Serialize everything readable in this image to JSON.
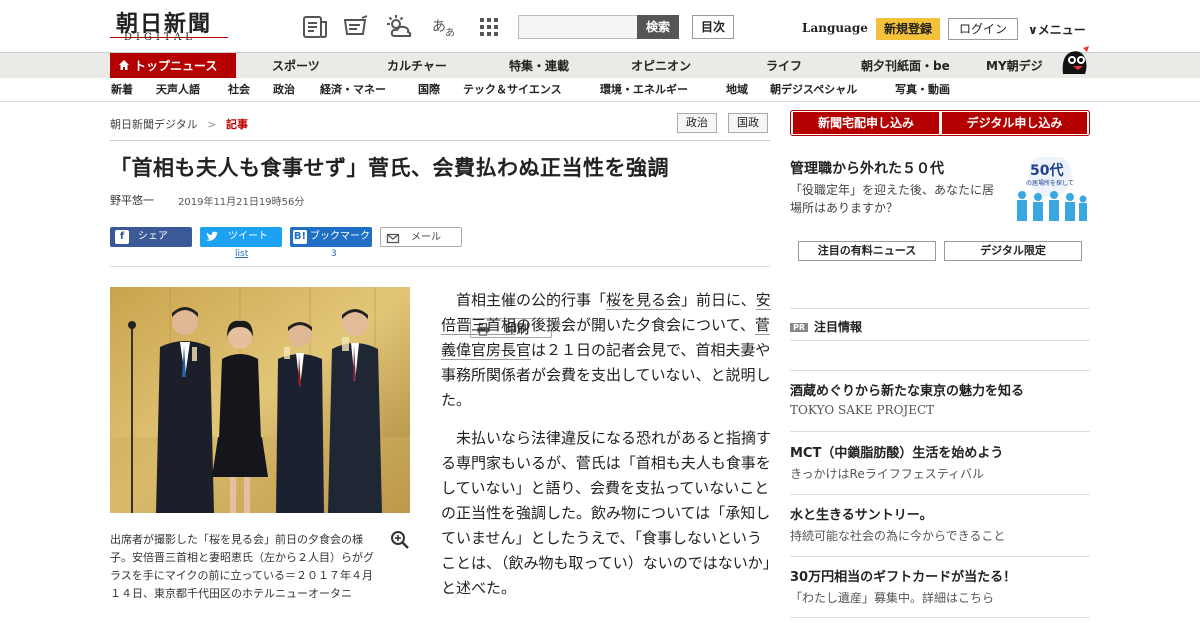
{
  "header": {
    "logo_kanji": "朝日新聞",
    "logo_sub": "DIGITAL",
    "search_button": "検索",
    "index_button": "目次",
    "language": "Language",
    "register": "新規登録",
    "login": "ログイン",
    "menu": "∨メニュー"
  },
  "nav_primary": {
    "top": "トップニュース",
    "items": [
      "スポーツ",
      "カルチャー",
      "特集・連載",
      "オピニオン",
      "ライフ",
      "朝夕刊紙面・be",
      "MY朝デジ"
    ]
  },
  "nav_secondary": {
    "items": [
      "新着",
      "天声人語",
      "社会",
      "政治",
      "経済・マネー",
      "国際",
      "テック＆サイエンス",
      "環境・エネルギー",
      "地域",
      "朝デジスペシャル",
      "写真・動画"
    ]
  },
  "breadcrumb": {
    "home": "朝日新聞デジタル",
    "sep": ">",
    "current": "記事"
  },
  "tags": [
    "政治",
    "国政"
  ],
  "article": {
    "title": "「首相も夫人も食事せず」菅氏、会費払わぬ正当性を強調",
    "author": "野平悠一",
    "date": "2019年11月21日19時56分",
    "caption": "出席者が撮影した「桜を見る会」前日の夕食会の様子。安倍晋三首相と妻昭恵氏（左から２人目）らがグラスを手にマイクの前に立っている＝２０１７年４月１４日、東京都千代田区のホテルニューオータニ",
    "p1_a": "首相主催の公的行事「",
    "p1_link1": "桜を見る会",
    "p1_b": "」前日に、",
    "p1_link2": "安倍晋三首相",
    "p1_c": "の後援会が開いた夕食会について、",
    "p1_link3": "菅義偉官房長官",
    "p1_d": "は２１日の記者会見で、首相夫妻や事務所関係者が会費を支出していない、と説明した。",
    "p2": "未払いなら法律違反になる恐れがあると指摘する専門家もいるが、菅氏は「首相も夫人も食事をしていない」と語り、会費を支払っていないことの正当性を強調した。飲み物については「承知していません」としたうえで、「食事しないということは、（飲み物も取ってい）ないのではないか」と述べた。"
  },
  "share": {
    "facebook": "シェア",
    "twitter": "ツイート",
    "hatena": "ブックマーク",
    "mail": "メール",
    "print": "印刷",
    "twitter_count": "list",
    "hatena_count": "3"
  },
  "sidebar": {
    "btn_newspaper": "新聞宅配申し込み",
    "btn_digital": "デジタル申し込み",
    "ad_title": "管理職から外れた５０代",
    "ad_sub": "「役職定年」を迎えた後、あなたに居場所はありますか？",
    "ad_img_big": "50代",
    "ad_img_small": "の居場所を探して",
    "tab_paid": "注目の有料ニュース",
    "tab_digital": "デジタル限定",
    "pr_badge": "PR",
    "pr_label": "注目情報",
    "pr_items": [
      {
        "title": "酒蔵めぐりから新たな東京の魅力を知る",
        "sub": "TOKYO SAKE PROJECT"
      },
      {
        "title": "MCT（中鎖脂肪酸）生活を始めよう",
        "sub": "きっかけはReライフフェスティバル"
      },
      {
        "title": "水と生きるサントリー。",
        "sub": "持続可能な社会の為に今からできること"
      },
      {
        "title": "30万円相当のギフトカードが当たる！",
        "sub": "「わたし遺産」募集中。詳細はこちら"
      }
    ]
  }
}
